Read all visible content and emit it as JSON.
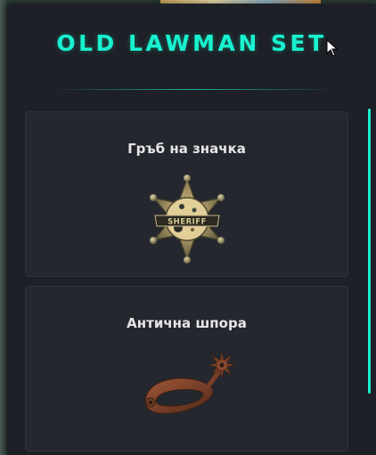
{
  "set": {
    "title": "OLD LAWMAN SET"
  },
  "items": [
    {
      "name": "Гръб на значка",
      "icon": "sheriff-badge-icon"
    },
    {
      "name": "Антична шпора",
      "icon": "spur-icon"
    }
  ],
  "colors": {
    "accent": "#18f2cf",
    "panel": "#1d2026",
    "card": "#24272e",
    "text": "#e6e6e6"
  }
}
